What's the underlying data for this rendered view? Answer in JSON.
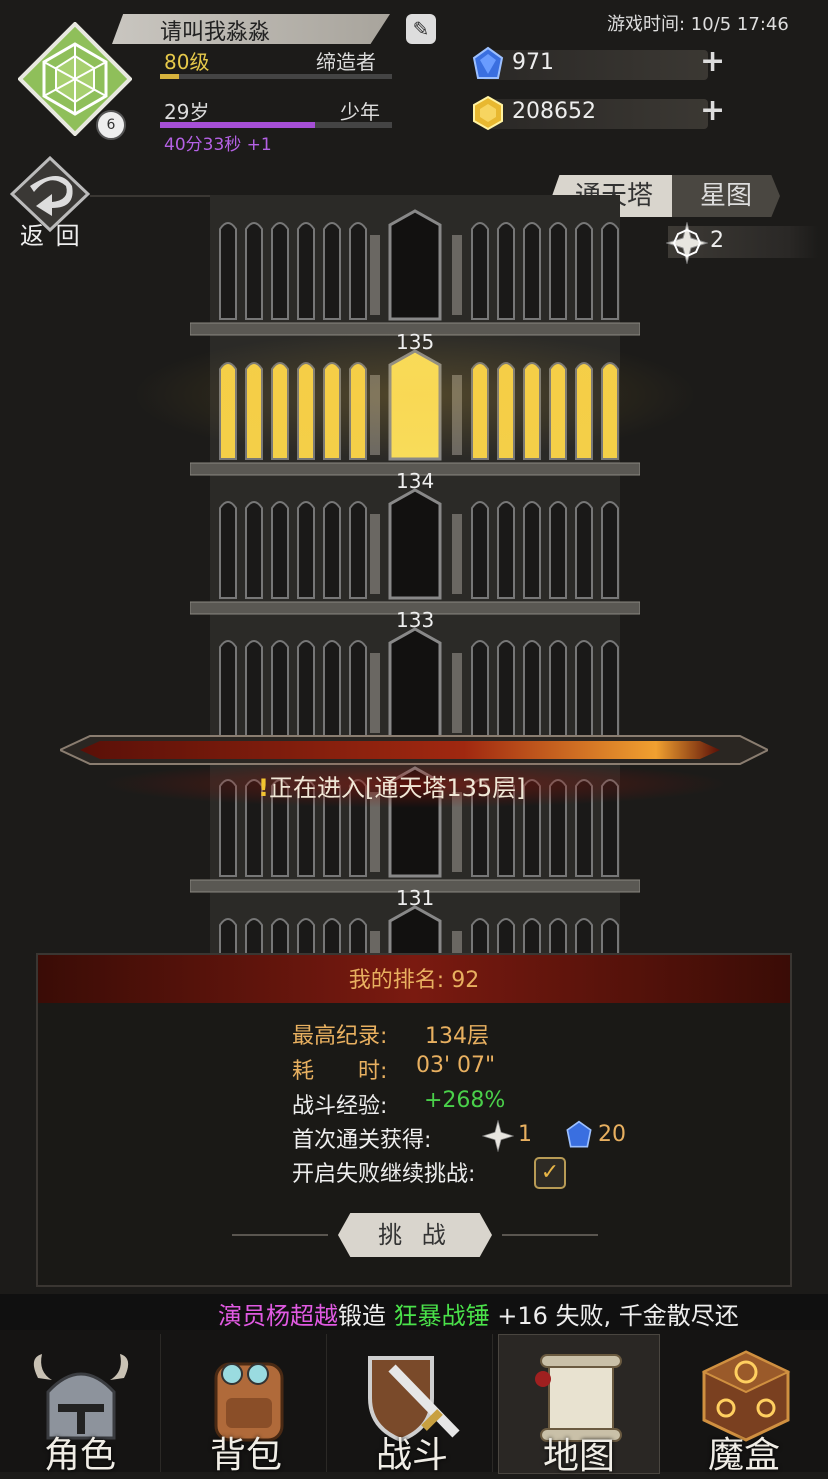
{
  "header": {
    "player_name": "请叫我淼淼",
    "level": "80级",
    "title": "缔造者",
    "level_progress": 0.08,
    "age": "29岁",
    "life_stage": "少年",
    "age_progress": 0.67,
    "age_timer": "40分33秒 +1",
    "avatar_badge": "6",
    "game_time": "游戏时间: 10/5 17:46",
    "gems": "971",
    "gold": "208652",
    "colors": {
      "gem": "#3a6fe0",
      "gold": "#e8b830",
      "accent_gold": "#e8b060"
    }
  },
  "back_label": "返 回",
  "tabs": [
    {
      "label": "通天塔",
      "active": true
    },
    {
      "label": "星图",
      "active": false
    }
  ],
  "star_count": "2",
  "tower": {
    "floors": [
      {
        "number": "135",
        "lit": true
      },
      {
        "number": "134",
        "lit": false
      },
      {
        "number": "133",
        "lit": false
      },
      {
        "number": "131",
        "lit": false
      }
    ]
  },
  "entering_text": "正在进入[通天塔135层]",
  "entering_mark": "!",
  "panel": {
    "rank_label": "我的排名: 92",
    "best_record_label": "最高纪录:",
    "best_record_value": "134层",
    "time_label": "耗　　时:",
    "time_value": "03' 07\"",
    "exp_label": "战斗经验:",
    "exp_value": "+268%",
    "first_clear_label": "首次通关获得:",
    "first_clear_star": "1",
    "first_clear_gem": "20",
    "continue_label": "开启失败继续挑战:",
    "continue_checked": true,
    "challenge_button": "挑 战"
  },
  "ticker": {
    "name": "演员杨超越",
    "action": "锻造 ",
    "item": "狂暴战锤",
    "rest": " +16 失败, 千金散尽还"
  },
  "nav": [
    {
      "label": "角色",
      "icon": "helmet-icon"
    },
    {
      "label": "背包",
      "icon": "backpack-icon"
    },
    {
      "label": "战斗",
      "icon": "sword-shield-icon"
    },
    {
      "label": "地图",
      "icon": "scroll-map-icon",
      "active": true
    },
    {
      "label": "魔盒",
      "icon": "magic-box-icon"
    }
  ]
}
